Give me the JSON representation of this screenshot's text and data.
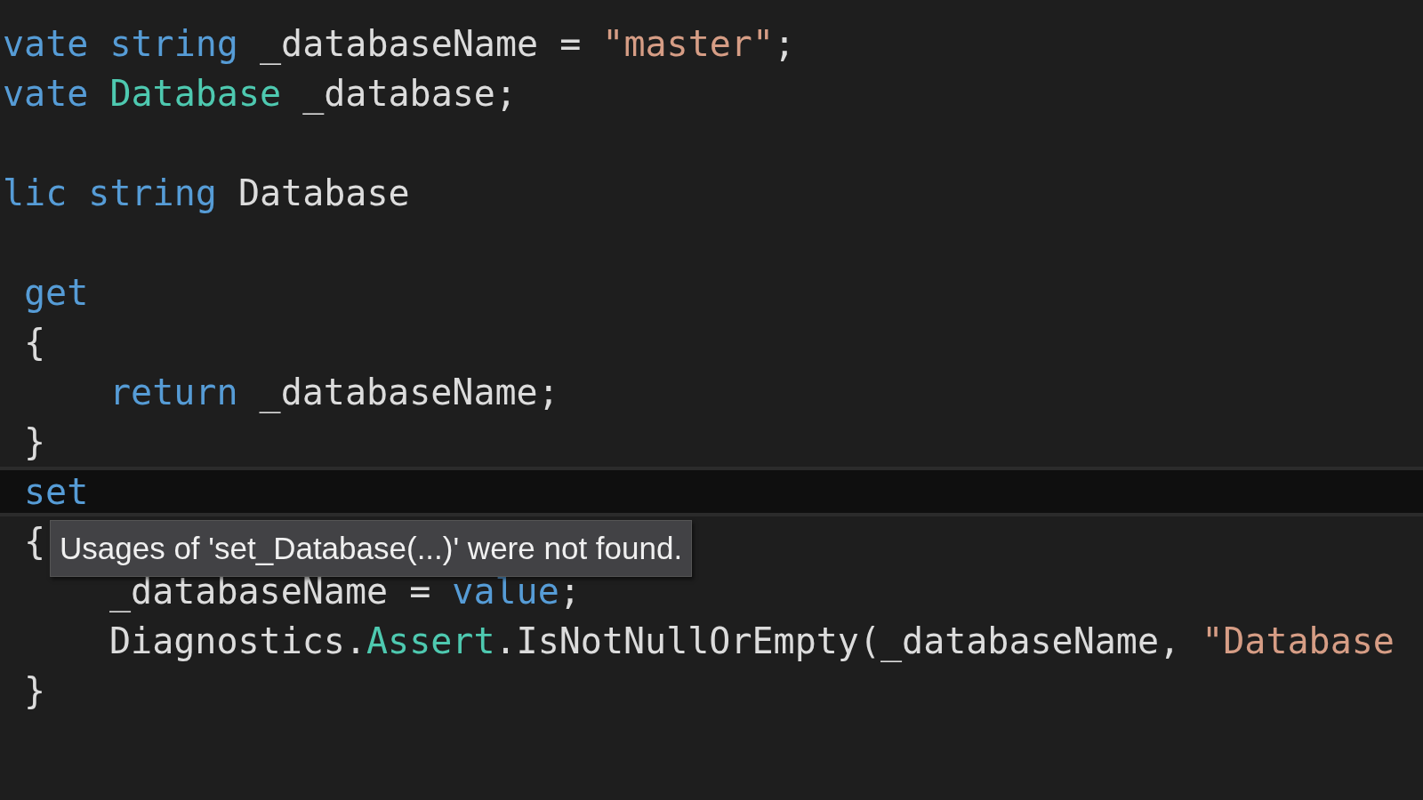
{
  "editor": {
    "lines": [
      {
        "kind": "member",
        "current": false,
        "tokens": [
          {
            "kind": "keyword",
            "text": "vate string"
          },
          {
            "kind": "plain",
            "text": " _databaseName = "
          },
          {
            "kind": "string",
            "text": "\"master\""
          },
          {
            "kind": "plain",
            "text": ";"
          }
        ]
      },
      {
        "kind": "member",
        "current": false,
        "tokens": [
          {
            "kind": "keyword",
            "text": "vate "
          },
          {
            "kind": "type",
            "text": "Database"
          },
          {
            "kind": "plain",
            "text": " _database;"
          }
        ]
      },
      {
        "kind": "blank",
        "current": false
      },
      {
        "kind": "member",
        "current": false,
        "tokens": [
          {
            "kind": "keyword",
            "text": "lic string"
          },
          {
            "kind": "plain",
            "text": " Database"
          }
        ]
      },
      {
        "kind": "blank",
        "current": false
      },
      {
        "kind": "accessor",
        "current": false,
        "tokens": [
          {
            "kind": "keyword",
            "text": "get"
          }
        ]
      },
      {
        "kind": "accessor",
        "current": false,
        "tokens": [
          {
            "kind": "plain",
            "text": "{"
          }
        ]
      },
      {
        "kind": "statement",
        "current": false,
        "tokens": [
          {
            "kind": "keyword",
            "text": "return"
          },
          {
            "kind": "plain",
            "text": " _databaseName;"
          }
        ]
      },
      {
        "kind": "accessor",
        "current": false,
        "tokens": [
          {
            "kind": "plain",
            "text": "}"
          }
        ]
      },
      {
        "kind": "accessor",
        "current": true,
        "tokens": [
          {
            "kind": "keyword",
            "text": "set"
          }
        ]
      },
      {
        "kind": "accessor",
        "current": false,
        "tokens": [
          {
            "kind": "plain",
            "text": "{"
          }
        ]
      },
      {
        "kind": "statement",
        "current": false,
        "tokens": [
          {
            "kind": "plain",
            "text": "_databaseName = "
          },
          {
            "kind": "keyword",
            "text": "value"
          },
          {
            "kind": "plain",
            "text": ";"
          }
        ]
      },
      {
        "kind": "statement",
        "current": false,
        "tokens": [
          {
            "kind": "plain",
            "text": "Diagnostics."
          },
          {
            "kind": "type",
            "text": "Assert"
          },
          {
            "kind": "plain",
            "text": ".IsNotNullOrEmpty(_databaseName, "
          },
          {
            "kind": "string",
            "text": "\"Database"
          }
        ]
      },
      {
        "kind": "accessor",
        "current": false,
        "tokens": [
          {
            "kind": "plain",
            "text": "}"
          }
        ]
      }
    ]
  },
  "tooltip": {
    "text": "Usages of 'set_Database(...)' were not found."
  }
}
